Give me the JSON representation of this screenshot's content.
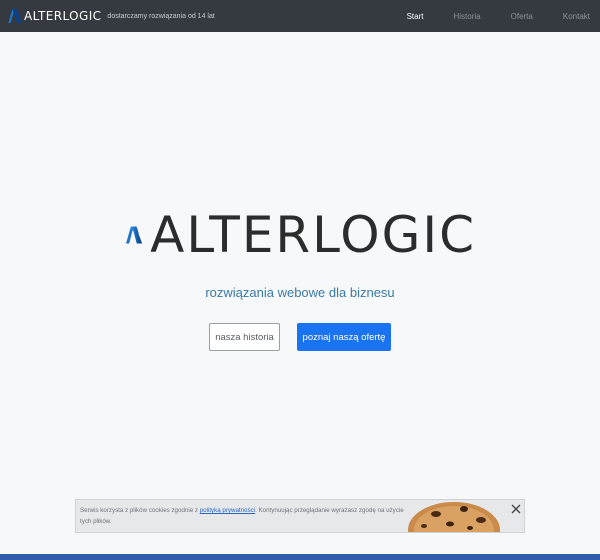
{
  "navbar": {
    "brand_name": "ALTERLOGIC",
    "tagline": "dostarczamy rozwiązania od 14 lat",
    "links": [
      {
        "label": "Start",
        "active": true
      },
      {
        "label": "Historia",
        "active": false
      },
      {
        "label": "Oferta",
        "active": false
      },
      {
        "label": "Kontakt",
        "active": false
      }
    ]
  },
  "hero": {
    "brand_name": "ALTERLOGIC",
    "tagline": "rozwiązania webowe dla biznesu",
    "buttons": {
      "history": "nasza historia",
      "offer": "poznaj naszą ofertę"
    }
  },
  "cookie_bar": {
    "text_before": "Serwis korzysta z plików cookies zgodnie z",
    "link_text": "polityką prywatności",
    "text_after": ". Kontynuując przeglądanie wyrażasz zgodę na użycie tych plików.",
    "close_icon": "close-icon",
    "image": "cookie-image"
  },
  "colors": {
    "navbar_bg": "#343a40",
    "page_bg": "#f7f8f9",
    "accent_blue": "#1a73f0",
    "tagline_blue": "#3a7aa6",
    "logo_dark_blue": "#0d3f86",
    "logo_light_blue": "#1c78c8"
  }
}
